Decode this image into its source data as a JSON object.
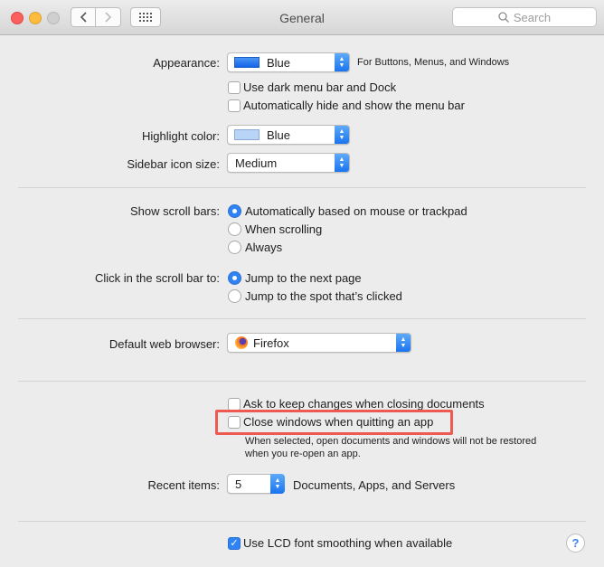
{
  "window": {
    "title": "General",
    "search_placeholder": "Search"
  },
  "appearance": {
    "label": "Appearance:",
    "value": "Blue",
    "note": "For Buttons, Menus, and Windows",
    "swatch_color": "#1c6ff0"
  },
  "dark_menu_bar": {
    "label": "Use dark menu bar and Dock",
    "checked": false
  },
  "auto_hide_menu": {
    "label": "Automatically hide and show the menu bar",
    "checked": false
  },
  "highlight": {
    "label": "Highlight color:",
    "value": "Blue",
    "swatch_color": "#b8d5f8"
  },
  "sidebar_icon": {
    "label": "Sidebar icon size:",
    "value": "Medium"
  },
  "scroll_bars": {
    "label": "Show scroll bars:",
    "options": [
      "Automatically based on mouse or trackpad",
      "When scrolling",
      "Always"
    ],
    "selected": 0
  },
  "scroll_click": {
    "label": "Click in the scroll bar to:",
    "options": [
      "Jump to the next page",
      "Jump to the spot that’s clicked"
    ],
    "selected": 0
  },
  "browser": {
    "label": "Default web browser:",
    "value": "Firefox"
  },
  "ask_keep": {
    "label": "Ask to keep changes when closing documents",
    "checked": false
  },
  "close_windows": {
    "label": "Close windows when quitting an app",
    "checked": false,
    "description_1": "When selected, open documents and windows will not be restored",
    "description_2": "when you re-open an app."
  },
  "recent": {
    "label": "Recent items:",
    "value": "5",
    "suffix": "Documents, Apps, and Servers"
  },
  "lcd": {
    "label": "Use LCD font smoothing when available",
    "checked": true
  },
  "help": "?"
}
